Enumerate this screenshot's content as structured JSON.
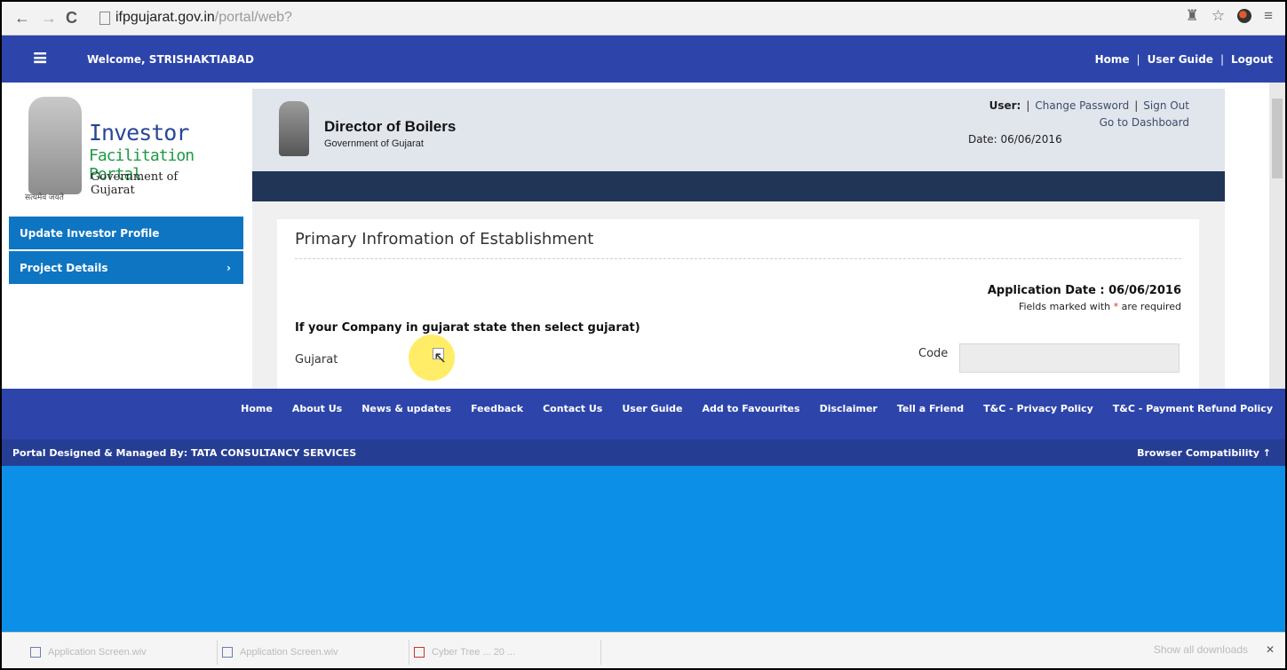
{
  "browser": {
    "url_host": "ifpgujarat.gov.in",
    "url_path": "/portal/web?",
    "back_icon": "←",
    "forward_icon": "→",
    "reload_icon": "C",
    "menu_icon": "≡",
    "star_icon": "☆",
    "pin_icon": "♜"
  },
  "topbar": {
    "menu_icon": "≡",
    "welcome": "Welcome, STRISHAKTIABAD",
    "links": [
      "Home",
      "User Guide",
      "Logout"
    ],
    "sep": "|"
  },
  "logo": {
    "line1": "Investor",
    "line2": "Facilitation Portal",
    "line3": "Government of Gujarat",
    "tagline": "सत्यमेव जयते"
  },
  "sidebar": {
    "items": [
      {
        "label": "Update Investor Profile",
        "arrow": ""
      },
      {
        "label": "Project Details",
        "arrow": "›"
      }
    ]
  },
  "inner_header": {
    "dept": "Director of Boilers",
    "sub": "Government of Gujarat",
    "user_label": "User:",
    "sep": "|",
    "change_password": "Change Password",
    "sign_out": "Sign Out",
    "dashboard": "Go to Dashboard",
    "date": "Date: 06/06/2016"
  },
  "form": {
    "title": "Primary Infromation of Establishment",
    "app_date": "Application Date : 06/06/2016",
    "req_pre": "Fields marked with",
    "req_star": "*",
    "req_post": "are required",
    "question": "If your Company in gujarat state then select gujarat)",
    "state_label": "Gujarat",
    "code_label": "Code",
    "code_value": "",
    "cursor_icon": "↖"
  },
  "footer": {
    "links": [
      "Home",
      "About Us",
      "News & updates",
      "Feedback",
      "Contact Us",
      "User Guide",
      "Add to Favourites",
      "Disclaimer",
      "Tell a Friend",
      "T&C - Privacy Policy",
      "T&C - Payment Refund Policy"
    ],
    "designed": "Portal Designed & Managed By: TATA CONSULTANCY SERVICES",
    "compat": "Browser Compatibility",
    "compat_arrow": "↑"
  },
  "downloads": {
    "items": [
      "Application Screen.wiv",
      "Application Screen.wiv",
      "Cyber Tree ... 20 ..."
    ],
    "show_all": "Show all downloads",
    "close": "✕"
  }
}
